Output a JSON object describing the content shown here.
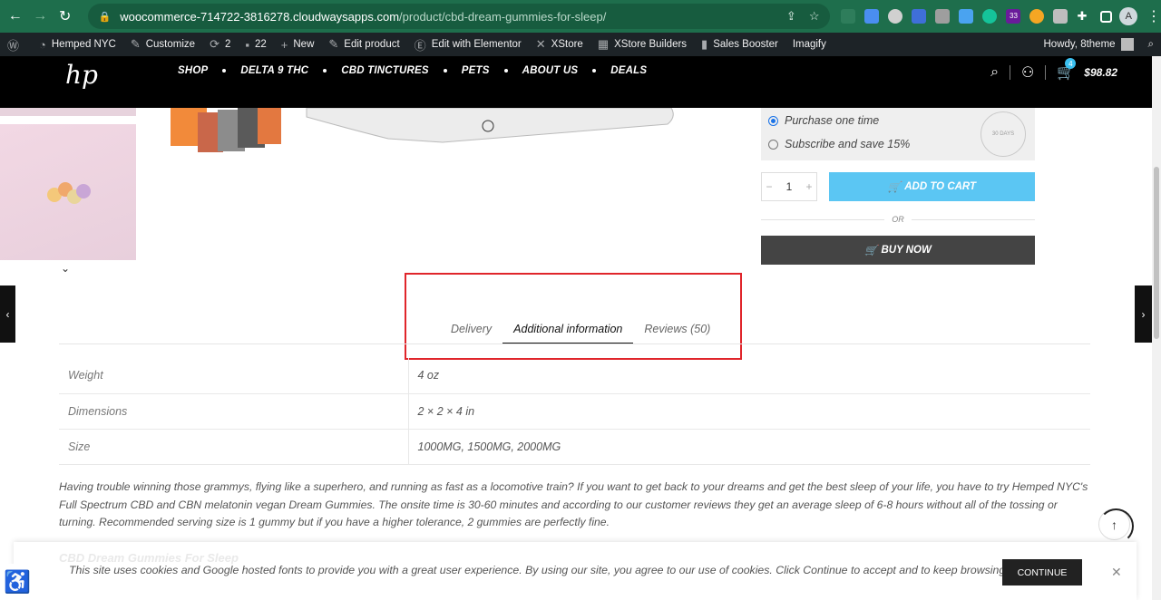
{
  "browser": {
    "url_host": "woocommerce-714722-3816278.cloudwaysapps.com",
    "url_path": "/product/cbd-dream-gummies-for-sleep/",
    "profile_initial": "A",
    "ext_badge": "33"
  },
  "wp_admin_bar": {
    "site_name": "Hemped NYC",
    "customize": "Customize",
    "updates": "2",
    "comments": "22",
    "new": "New",
    "edit_product": "Edit product",
    "edit_elementor": "Edit with Elementor",
    "xstore": "XStore",
    "xstore_builders": "XStore Builders",
    "sales_booster": "Sales Booster",
    "imagify": "Imagify",
    "howdy": "Howdy, 8theme"
  },
  "header": {
    "logo": "hp",
    "nav": [
      "SHOP",
      "DELTA 9 THC",
      "CBD TINCTURES",
      "PETS",
      "ABOUT US",
      "DEALS"
    ],
    "cart_count": "4",
    "cart_total": "$98.82"
  },
  "purchase": {
    "option_one_time": "Purchase one time",
    "option_subscribe": "Subscribe and save  15%",
    "seal_text": "30 DAYS",
    "quantity": "1",
    "add_to_cart": "ADD TO CART",
    "or": "OR",
    "buy_now": "BUY NOW"
  },
  "tabs": [
    "Delivery",
    "Additional information",
    "Reviews (50)"
  ],
  "attributes": [
    {
      "key": "Weight",
      "value": "4 oz"
    },
    {
      "key": "Dimensions",
      "value": "2 × 2 × 4 in"
    },
    {
      "key": "Size",
      "value": "1000MG, 1500MG, 2000MG"
    }
  ],
  "description": "Having trouble winning those grammys, flying like a superhero, and running as fast as a locomotive train? If you want to get back to your dreams and get the best sleep of your life, you have to try Hemped NYC's Full Spectrum CBD and CBN melatonin vegan Dream Gummies. The onsite time is 30-60 minutes and according to our customer reviews they get an average sleep of 6-8 hours without all of the tossing or turning. Recommended serving size is 1 gummy but if you have a higher tolerance, 2 gummies are perfectly fine.",
  "cookie": {
    "text": "This site uses cookies and Google hosted fonts to provide you with a great user experience. By using our site, you agree to our use of cookies. Click Continue to accept and to keep browsing.",
    "button": "CONTINUE",
    "underlay": "CBD Dream Gummies For Sleep"
  },
  "colors": {
    "accent": "#5bc6f3",
    "highlight": "#e0252b",
    "chrome": "#1e6e4c"
  }
}
